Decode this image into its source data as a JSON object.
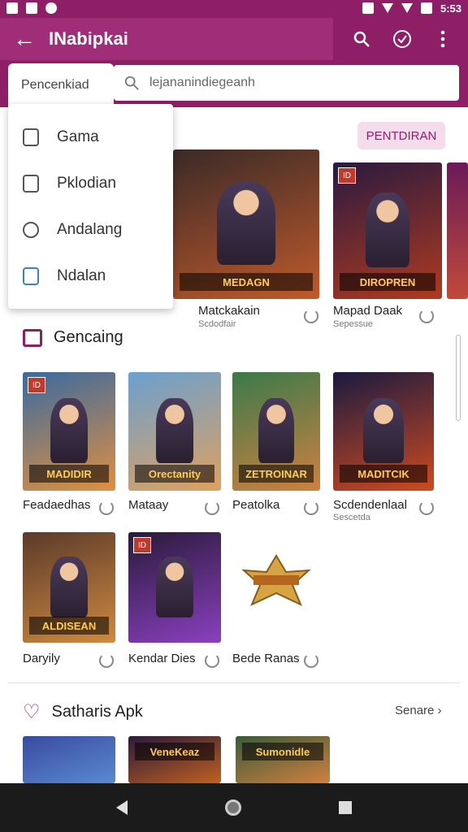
{
  "status_bar": {
    "time": "5:53"
  },
  "app_bar": {
    "title": "INabipkai"
  },
  "search": {
    "filter_label": "Pencenkiad",
    "placeholder": "lejananindiegeanh"
  },
  "dropdown": {
    "items": [
      {
        "label": "Gama",
        "icon": "gamepad-icon"
      },
      {
        "label": "Pklodian",
        "icon": "tablet-icon"
      },
      {
        "label": "Andalang",
        "icon": "info-icon"
      },
      {
        "label": "Ndalan",
        "icon": "calendar-check-icon"
      }
    ]
  },
  "featured": {
    "button_label": "PENTDIRAN",
    "apps": [
      {
        "name": "Matckakain",
        "sub": "Scdodfair",
        "banner": "MEDAGN",
        "colors": [
          "#3a2a28",
          "#c05a2a"
        ]
      },
      {
        "name": "Mapad Daak",
        "sub": "Sepessue",
        "banner": "DIROPREN",
        "colors": [
          "#2a1a40",
          "#b03a20"
        ]
      }
    ]
  },
  "section1": {
    "title": "Gencaing",
    "apps": [
      {
        "name": "Feadaedhas",
        "sub": "",
        "banner": "MADIDIR",
        "colors": [
          "#3a6aa0",
          "#e09040"
        ]
      },
      {
        "name": "Mataay",
        "sub": "",
        "banner": "Orectanity",
        "colors": [
          "#6aa0d0",
          "#e0a060"
        ]
      },
      {
        "name": "Peatolka",
        "sub": "",
        "banner": "ZETROINAR",
        "colors": [
          "#3a7a4a",
          "#d08040"
        ]
      },
      {
        "name": "Scdendenlaal",
        "sub": "Sescetda",
        "banner": "MADITCIK",
        "colors": [
          "#1a1a40",
          "#d04a20"
        ]
      },
      {
        "name": "Daryily",
        "sub": "",
        "banner": "ALDISEAN",
        "colors": [
          "#5a3a2a",
          "#d08a40"
        ]
      },
      {
        "name": "Kendar Dies",
        "sub": "",
        "banner": "",
        "colors": [
          "#2a1a3a",
          "#8a40c0"
        ]
      },
      {
        "name": "Bede Ranas",
        "sub": "",
        "banner": "",
        "colors": [
          "#ffffff",
          "#ffffff"
        ]
      }
    ]
  },
  "section2": {
    "title": "Satharis Apk",
    "see_more": "Senare",
    "apps": [
      {
        "banner": "",
        "colors": [
          "#3a4aa0",
          "#5a8ad0"
        ]
      },
      {
        "banner": "VeneKeaz",
        "colors": [
          "#2a1a3a",
          "#c06020"
        ]
      },
      {
        "banner": "Sumonidle",
        "colors": [
          "#3a5a3a",
          "#d08040"
        ]
      }
    ]
  }
}
